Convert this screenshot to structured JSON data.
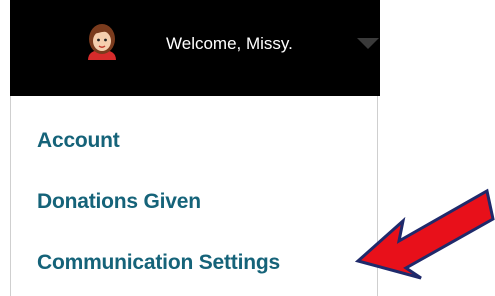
{
  "header": {
    "welcome_text": "Welcome, Missy."
  },
  "menu": {
    "items": [
      {
        "label": "Account"
      },
      {
        "label": "Donations Given"
      },
      {
        "label": "Communication Settings"
      }
    ]
  },
  "colors": {
    "header_bg": "#000000",
    "menu_text": "#156379",
    "arrow": "#e8101a"
  },
  "icons": [
    "user-avatar",
    "caret-down-icon",
    "red-arrow-annotation"
  ]
}
